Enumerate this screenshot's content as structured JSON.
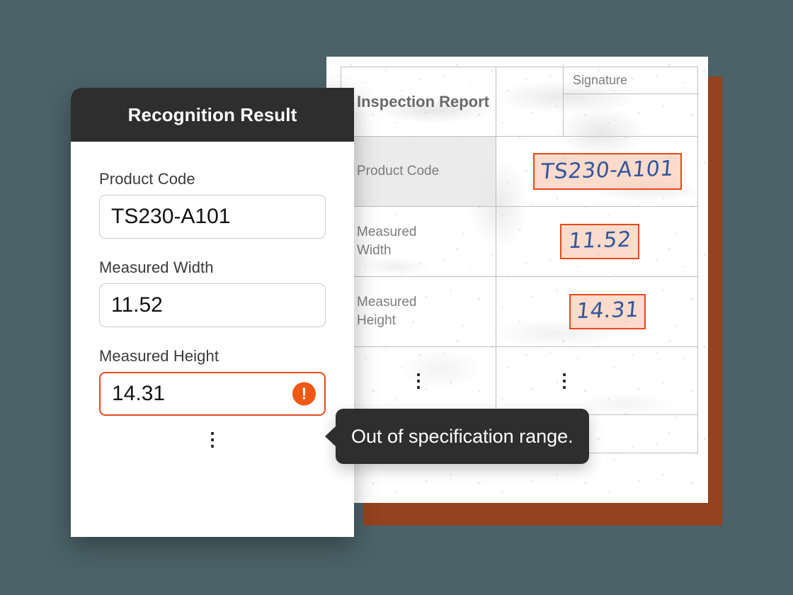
{
  "theme": {
    "background": "#4a6268",
    "panel_header_bg": "#2e2e2e",
    "accent_orange": "#e8491b",
    "alert_badge_bg": "#ef5713",
    "document_backing": "#95421e",
    "handwriting_ink": "#33569e",
    "ocr_box_fill": "#f7bea0"
  },
  "panel": {
    "title": "Recognition Result",
    "fields": [
      {
        "label": "Product Code",
        "value": "TS230-A101",
        "state": "normal"
      },
      {
        "label": "Measured Width",
        "value": "11.52",
        "state": "normal"
      },
      {
        "label": "Measured Height",
        "value": "14.31",
        "state": "error",
        "alert_icon": "exclamation-circle-icon"
      }
    ],
    "more_indicator": "⋮"
  },
  "tooltip": {
    "message": "Out of specification range.",
    "arrow": "left"
  },
  "document": {
    "title": "Inspection Report",
    "signature_header": "Signature",
    "signature_value": "",
    "rows": [
      {
        "label": "Product Code",
        "handwriting": "TS230-A101",
        "detected": true
      },
      {
        "label": "Measured Width",
        "handwriting": "11.52",
        "detected": true
      },
      {
        "label": "Measured Height",
        "handwriting": "14.31",
        "detected": true
      }
    ],
    "continuation_left": "⋮",
    "continuation_right": "⋮"
  }
}
